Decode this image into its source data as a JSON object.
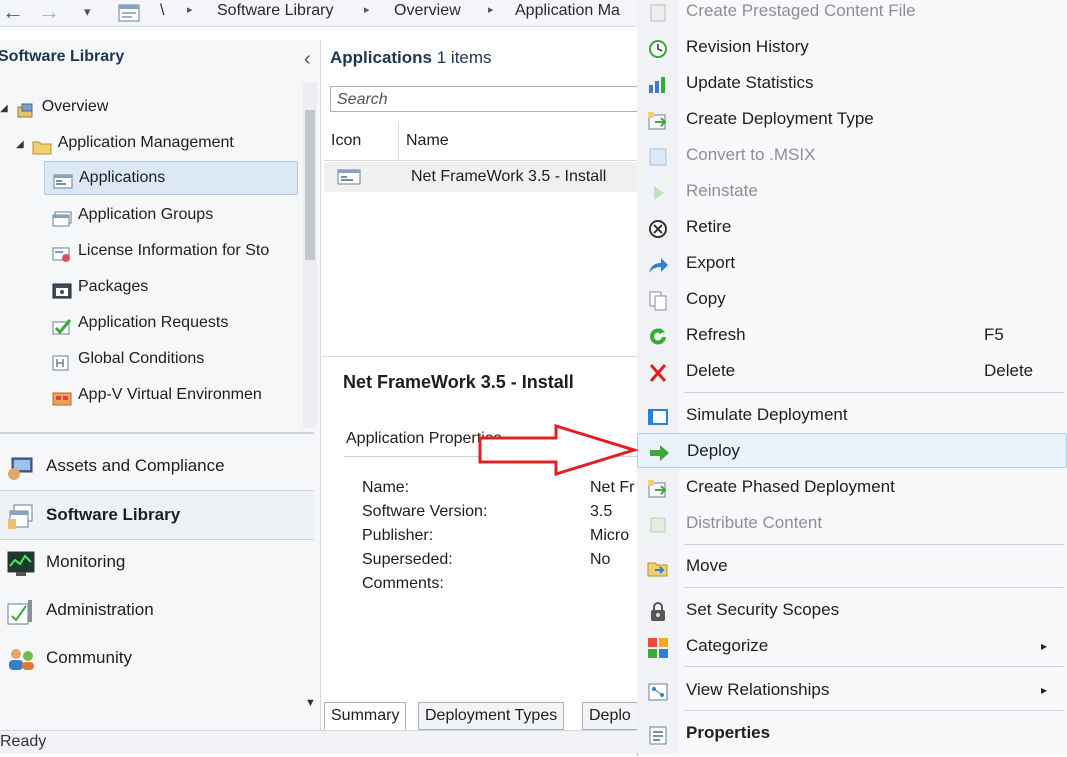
{
  "breadcrumb": {
    "back_arrow": "←",
    "forward_arrow": "→",
    "dropdown": "▾",
    "root_sep": "\\",
    "items": [
      "Software Library",
      "Overview",
      "Application Ma"
    ],
    "sep_glyph": "▸"
  },
  "left_pane": {
    "title": "Software Library",
    "collapse_glyph": "‹",
    "tree": [
      {
        "label": "Overview",
        "icon": "overview-icon"
      },
      {
        "label": "Application Management",
        "icon": "folder-icon"
      },
      {
        "label": "Applications",
        "icon": "application-icon",
        "selected": true
      },
      {
        "label": "Application Groups",
        "icon": "application-groups-icon"
      },
      {
        "label": "License Information for Sto",
        "icon": "license-icon"
      },
      {
        "label": "Packages",
        "icon": "package-icon"
      },
      {
        "label": "Application Requests",
        "icon": "requests-icon"
      },
      {
        "label": "Global Conditions",
        "icon": "conditions-icon"
      },
      {
        "label": "App-V Virtual Environmen",
        "icon": "appv-icon"
      }
    ],
    "expand_glyph": "◢",
    "workspaces": [
      {
        "label": "Assets and Compliance",
        "icon": "assets-icon"
      },
      {
        "label": "Software Library",
        "icon": "software-library-icon",
        "active": true
      },
      {
        "label": "Monitoring",
        "icon": "monitoring-icon"
      },
      {
        "label": "Administration",
        "icon": "administration-icon"
      },
      {
        "label": "Community",
        "icon": "community-icon"
      }
    ]
  },
  "main_pane": {
    "title": "Applications",
    "count": "1 items",
    "search_placeholder": "Search",
    "columns": [
      "Icon",
      "Name"
    ],
    "rows": [
      {
        "name": "Net FrameWork 3.5 - Install"
      }
    ],
    "detail_title": "Net FrameWork 3.5 - Install",
    "props_title": "Application Properties",
    "props": [
      {
        "label": "Name:",
        "value": "Net Fr"
      },
      {
        "label": "Software Version:",
        "value": "3.5"
      },
      {
        "label": "Publisher:",
        "value": "Micro"
      },
      {
        "label": "Superseded:",
        "value": "No"
      },
      {
        "label": "Comments:",
        "value": ""
      }
    ],
    "tabs": [
      "Summary",
      "Deployment Types",
      "Deplo"
    ]
  },
  "status": "Ready",
  "context_menu": {
    "items": [
      {
        "label": "Create Prestaged Content File",
        "icon": "prestaged-content-icon",
        "disabled": true
      },
      {
        "label": "Revision History",
        "icon": "revision-history-icon"
      },
      {
        "label": "Update Statistics",
        "icon": "statistics-icon"
      },
      {
        "label": "Create Deployment Type",
        "icon": "deployment-type-icon"
      },
      {
        "label": "Convert to .MSIX",
        "icon": "msix-icon",
        "disabled": true
      },
      {
        "label": "Reinstate",
        "icon": "reinstate-icon",
        "disabled": true
      },
      {
        "label": "Retire",
        "icon": "retire-icon"
      },
      {
        "label": "Export",
        "icon": "export-icon"
      },
      {
        "label": "Copy",
        "icon": "copy-icon"
      },
      {
        "label": "Refresh",
        "icon": "refresh-icon",
        "shortcut": "F5"
      },
      {
        "label": "Delete",
        "icon": "delete-icon",
        "shortcut": "Delete"
      },
      {
        "label": "Simulate Deployment",
        "icon": "simulate-icon"
      },
      {
        "label": "Deploy",
        "icon": "deploy-icon",
        "highlighted": true
      },
      {
        "label": "Create Phased Deployment",
        "icon": "phased-deployment-icon"
      },
      {
        "label": "Distribute Content",
        "icon": "distribute-icon",
        "disabled": true
      },
      {
        "label": "Move",
        "icon": "move-icon"
      },
      {
        "label": "Set Security Scopes",
        "icon": "security-scopes-icon"
      },
      {
        "label": "Categorize",
        "icon": "categorize-icon",
        "submenu": true
      },
      {
        "label": "View Relationships",
        "icon": "relationships-icon",
        "submenu": true
      },
      {
        "label": "Properties",
        "icon": "properties-icon",
        "bold": true
      }
    ],
    "submenu_glyph": "▸"
  },
  "colors": {
    "arrow_annotation": "#e02020",
    "deploy_green": "#3aa935",
    "selection": "#dde8f5"
  }
}
